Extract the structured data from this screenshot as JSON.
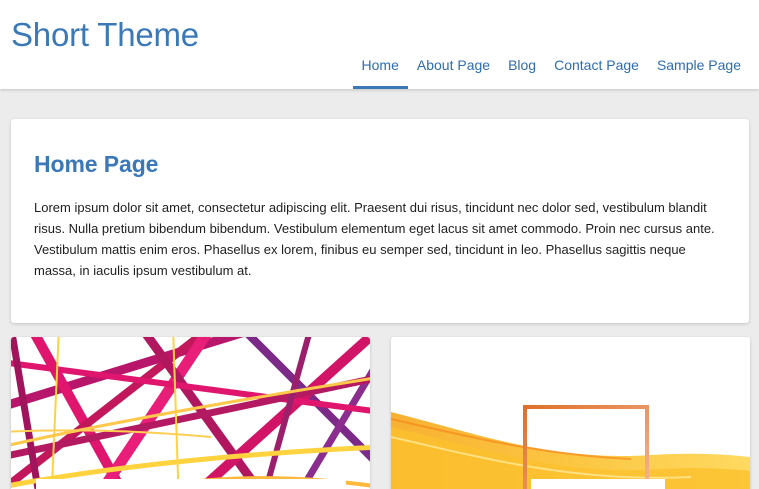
{
  "site": {
    "title": "Short Theme"
  },
  "nav": {
    "items": [
      {
        "label": "Home",
        "active": true
      },
      {
        "label": "About Page",
        "active": false
      },
      {
        "label": "Blog",
        "active": false
      },
      {
        "label": "Contact Page",
        "active": false
      },
      {
        "label": "Sample Page",
        "active": false
      }
    ]
  },
  "main": {
    "heading": "Home Page",
    "body": "Lorem ipsum dolor sit amet, consectetur adipiscing elit. Praesent dui risus, tincidunt nec dolor sed, vestibulum blandit risus. Nulla pretium bibendum bibendum. Vestibulum elementum eget lacus sit amet commodo. Proin nec cursus ante. Vestibulum mattis enim eros. Phasellus ex lorem, finibus eu semper sed, tincidunt in leo. Phasellus sagittis neque massa, in iaculis ipsum vestibulum at."
  },
  "posts": [
    {
      "image": "abstract-pink-purple-stripes"
    },
    {
      "image": "abstract-orange-wave-frame"
    }
  ],
  "colors": {
    "accent": "#3a78b8",
    "background": "#ececec"
  }
}
